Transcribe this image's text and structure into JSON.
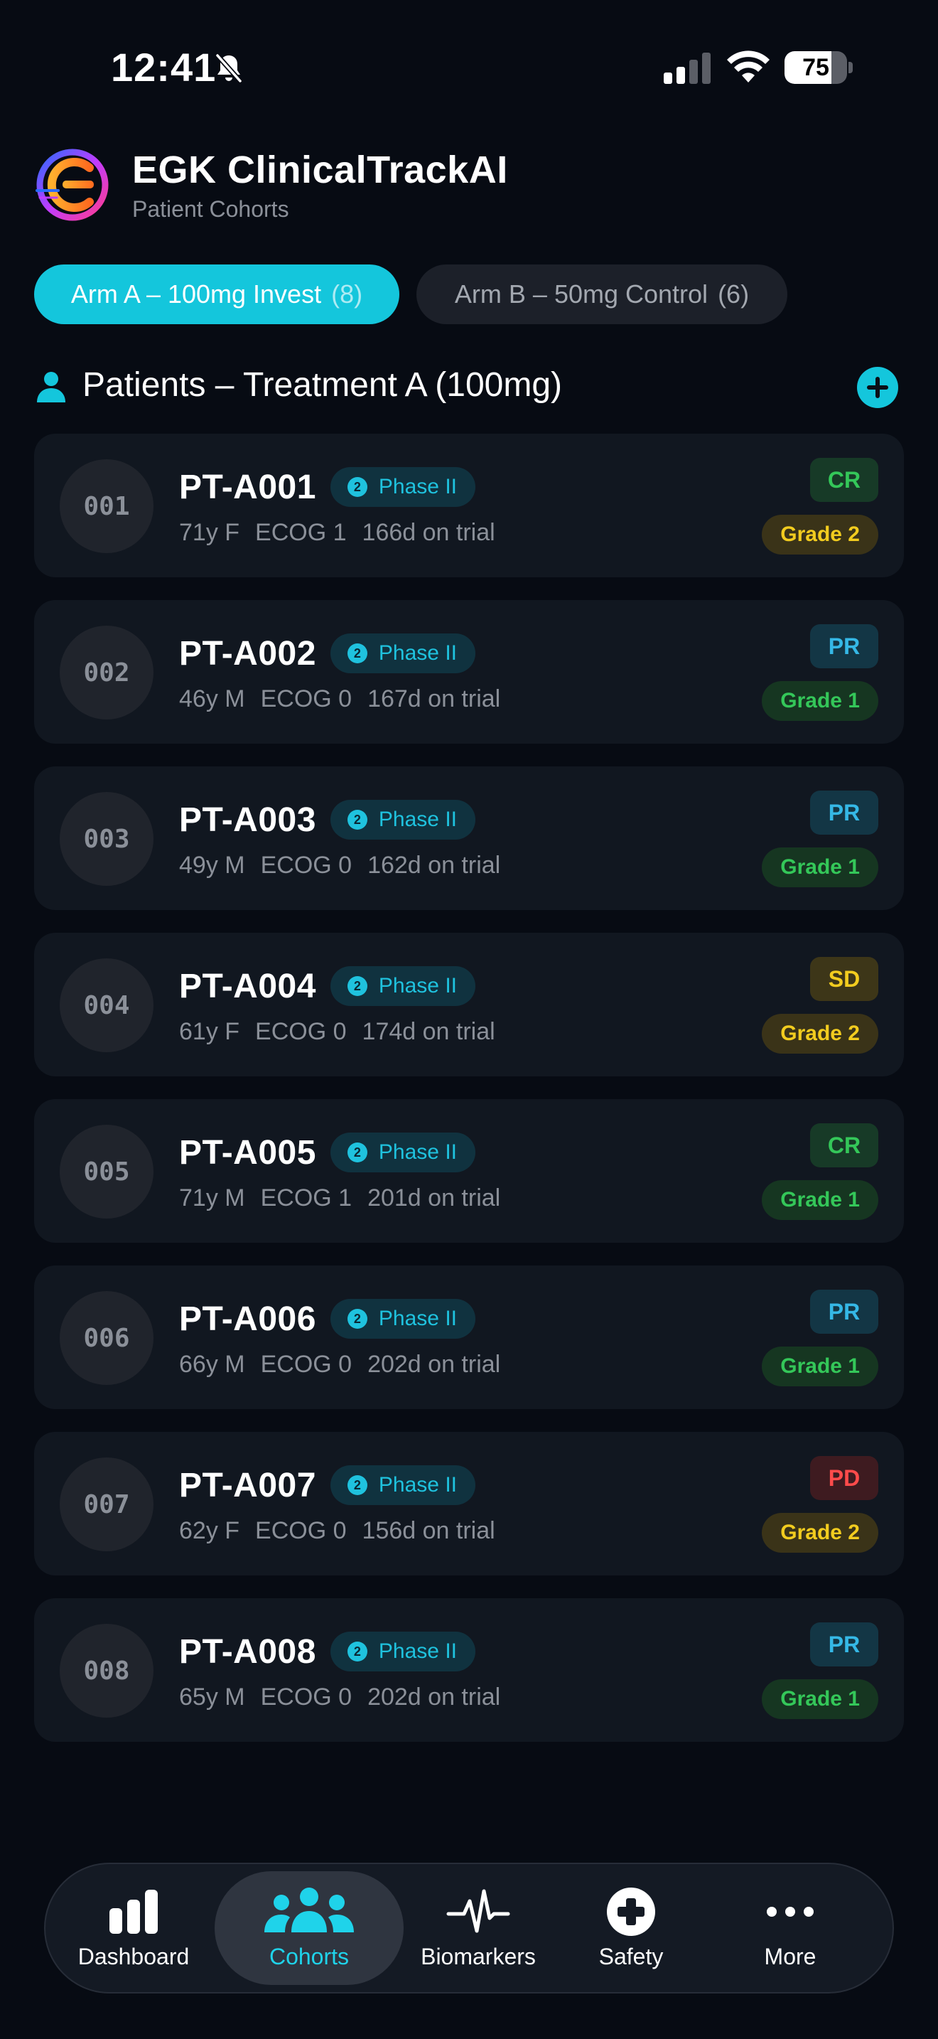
{
  "status_bar": {
    "time": "12:41",
    "battery": "75",
    "battery_level": 0.75
  },
  "header": {
    "title": "EGK ClinicalTrackAI",
    "subtitle": "Patient Cohorts"
  },
  "tabs": [
    {
      "label": "Arm A – 100mg Invest",
      "count": "(8)",
      "active": true
    },
    {
      "label": "Arm B – 50mg Control",
      "count": "(6)",
      "active": false
    }
  ],
  "section": {
    "title": "Patients – Treatment A (100mg)"
  },
  "colors": {
    "accent": "#14c6dc",
    "cr_text": "#34c759",
    "cr_bg": "#173a27",
    "pr_text": "#35b8e6",
    "pr_bg": "#133645",
    "sd_text": "#f2cc1f",
    "sd_bg": "#3d3618",
    "pd_text": "#ff4b4b",
    "pd_bg": "#3e1b20",
    "grade1_text": "#34c759",
    "grade1_bg": "#163621",
    "grade2_text": "#f2cc1f",
    "grade2_bg": "#3a3318"
  },
  "patients": [
    {
      "num": "001",
      "id": "PT-A001",
      "phase_num": "2",
      "phase": "Phase II",
      "age_sex": "71y F",
      "ecog": "ECOG 1",
      "days": "166d on trial",
      "response": "CR",
      "grade": "Grade 2"
    },
    {
      "num": "002",
      "id": "PT-A002",
      "phase_num": "2",
      "phase": "Phase II",
      "age_sex": "46y M",
      "ecog": "ECOG 0",
      "days": "167d on trial",
      "response": "PR",
      "grade": "Grade 1"
    },
    {
      "num": "003",
      "id": "PT-A003",
      "phase_num": "2",
      "phase": "Phase II",
      "age_sex": "49y M",
      "ecog": "ECOG 0",
      "days": "162d on trial",
      "response": "PR",
      "grade": "Grade 1"
    },
    {
      "num": "004",
      "id": "PT-A004",
      "phase_num": "2",
      "phase": "Phase II",
      "age_sex": "61y F",
      "ecog": "ECOG 0",
      "days": "174d on trial",
      "response": "SD",
      "grade": "Grade 2"
    },
    {
      "num": "005",
      "id": "PT-A005",
      "phase_num": "2",
      "phase": "Phase II",
      "age_sex": "71y M",
      "ecog": "ECOG 1",
      "days": "201d on trial",
      "response": "CR",
      "grade": "Grade 1"
    },
    {
      "num": "006",
      "id": "PT-A006",
      "phase_num": "2",
      "phase": "Phase II",
      "age_sex": "66y M",
      "ecog": "ECOG 0",
      "days": "202d on trial",
      "response": "PR",
      "grade": "Grade 1"
    },
    {
      "num": "007",
      "id": "PT-A007",
      "phase_num": "2",
      "phase": "Phase II",
      "age_sex": "62y F",
      "ecog": "ECOG 0",
      "days": "156d on trial",
      "response": "PD",
      "grade": "Grade 2"
    },
    {
      "num": "008",
      "id": "PT-A008",
      "phase_num": "2",
      "phase": "Phase II",
      "age_sex": "65y M",
      "ecog": "ECOG 0",
      "days": "202d on trial",
      "response": "PR",
      "grade": "Grade 1"
    }
  ],
  "nav": [
    {
      "label": "Dashboard",
      "icon": "bar-chart-icon",
      "active": false
    },
    {
      "label": "Cohorts",
      "icon": "people-icon",
      "active": true
    },
    {
      "label": "Biomarkers",
      "icon": "pulse-icon",
      "active": false
    },
    {
      "label": "Safety",
      "icon": "medical-cross-icon",
      "active": false
    },
    {
      "label": "More",
      "icon": "more-dots-icon",
      "active": false
    }
  ]
}
